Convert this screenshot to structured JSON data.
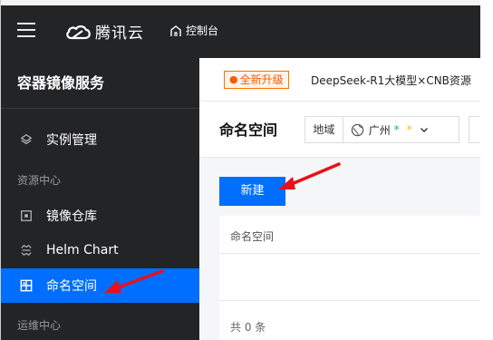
{
  "topbar": {
    "brand": "腾讯云",
    "console_label": "控制台"
  },
  "sidebar": {
    "title": "容器镜像服务",
    "items": [
      {
        "label": "实例管理"
      },
      {
        "label": "镜像仓库"
      },
      {
        "label": "Helm Chart"
      },
      {
        "label": "命名空间",
        "active": true
      }
    ],
    "groups": [
      "资源中心",
      "运维中心"
    ]
  },
  "notice": {
    "badge": "全新升级",
    "text": "DeepSeek-R1大模型×CNB资源"
  },
  "header": {
    "title": "命名空间",
    "region_label": "地域",
    "region_value": "广州",
    "star_1": "*",
    "star_2": "*"
  },
  "toolbar": {
    "new_label": "新建"
  },
  "table": {
    "columns": [
      "命名空间"
    ],
    "rows": [],
    "footer": "共 0 条"
  },
  "colors": {
    "accent": "#006eff",
    "sidebar_bg": "#232426",
    "annotation_arrow": "#e8111a",
    "badge": "#ff5a00"
  }
}
